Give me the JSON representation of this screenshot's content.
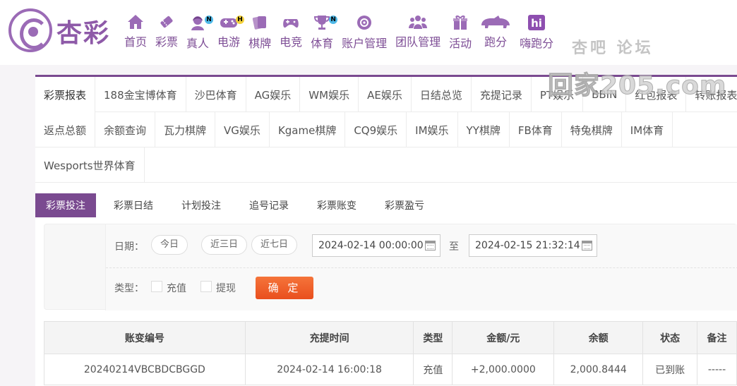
{
  "brand": {
    "name": "杏彩"
  },
  "nav": [
    {
      "label": "首页",
      "icon": "home-icon"
    },
    {
      "label": "彩票",
      "icon": "lottery-ticket-icon"
    },
    {
      "label": "真人",
      "icon": "live-dealer-icon",
      "badge": "N"
    },
    {
      "label": "电游",
      "icon": "gamepad-icon",
      "badge": "H"
    },
    {
      "label": "棋牌",
      "icon": "cards-icon"
    },
    {
      "label": "电竞",
      "icon": "esports-controller-icon"
    },
    {
      "label": "体育",
      "icon": "trophy-icon",
      "badge": "N"
    },
    {
      "label": "账户管理",
      "icon": "account-icon"
    },
    {
      "label": "团队管理",
      "icon": "team-icon"
    },
    {
      "label": "活动",
      "icon": "gift-icon"
    },
    {
      "label": "跑分",
      "icon": "rhino-icon"
    },
    {
      "label": "嗨跑分",
      "icon": "hi-icon"
    }
  ],
  "watermark": {
    "top": "杏吧  论坛",
    "bottom": "回家205.com"
  },
  "tabs": {
    "row1": [
      "彩票报表",
      "188金宝博体育",
      "沙巴体育",
      "AG娱乐",
      "WM娱乐",
      "AE娱乐",
      "日结总览",
      "充提记录",
      "PT娱乐",
      "BBIN",
      "红包报表",
      "转账报表"
    ],
    "row2": [
      "返点总额",
      "余额查询",
      "瓦力棋牌",
      "VG娱乐",
      "Kgame棋牌",
      "CQ9娱乐",
      "IM娱乐",
      "YY棋牌",
      "FB体育",
      "特兔棋牌",
      "IM体育"
    ],
    "row3": [
      "Wesports世界体育"
    ]
  },
  "subtabs": [
    "彩票投注",
    "彩票日结",
    "计划投注",
    "追号记录",
    "彩票账变",
    "彩票盈亏"
  ],
  "filter": {
    "date_label": "日期：",
    "quick": [
      "今日",
      "近三日",
      "近七日"
    ],
    "start": "2024-02-14 00:00:00",
    "to": "至",
    "end": "2024-02-15 21:32:14",
    "type_label": "类型：",
    "types": [
      "充值",
      "提现"
    ],
    "confirm": "确 定"
  },
  "table": {
    "headers": [
      "账变编号",
      "充提时间",
      "类型",
      "金额/元",
      "余额",
      "状态",
      "备注"
    ],
    "rows": [
      [
        "20240214VBCBDCBGGD",
        "2024-02-14 16:00:18",
        "充值",
        "+2,000.0000",
        "2,000.8444",
        "已到账",
        "-----"
      ]
    ]
  },
  "colors": {
    "brand": "#7a4a90",
    "accent": "#e94f1e",
    "amount": "#d8212a",
    "ok": "#3b9c2f"
  }
}
